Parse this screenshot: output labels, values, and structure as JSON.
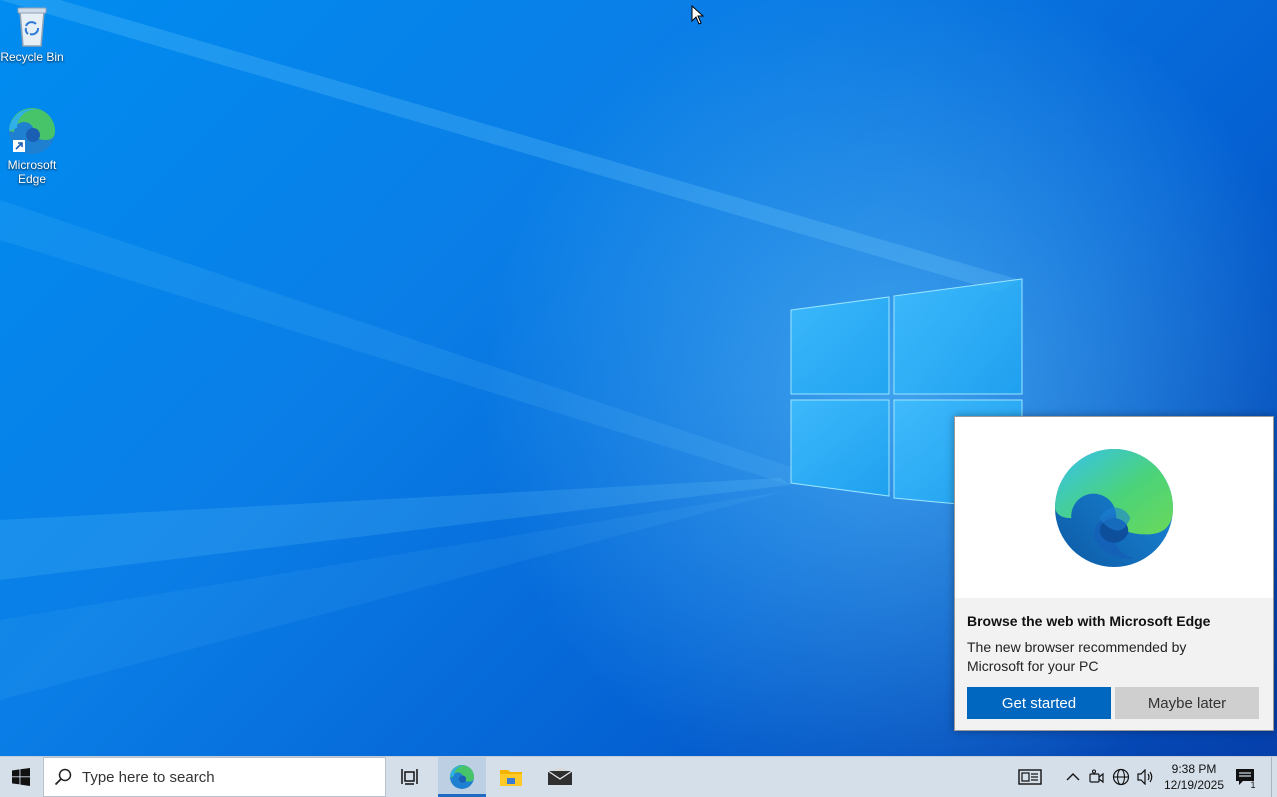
{
  "desktop": {
    "icons": [
      {
        "label": "Recycle Bin",
        "icon": "recycle-bin-icon"
      },
      {
        "label": "Microsoft Edge",
        "icon": "edge-icon"
      }
    ]
  },
  "popup": {
    "title": "Browse the web with Microsoft Edge",
    "body": "The new browser recommended by Microsoft for your PC",
    "primary_button": "Get started",
    "secondary_button": "Maybe later",
    "logo": "edge-logo"
  },
  "taskbar": {
    "search_placeholder": "Type here to search",
    "pinned": [
      "task-view-icon",
      "edge-icon",
      "file-explorer-icon",
      "mail-icon"
    ],
    "tray": {
      "icons": [
        "news-icon",
        "chevron-up-icon",
        "meet-now-icon",
        "network-icon",
        "volume-icon",
        "notifications-icon"
      ],
      "time": "9:38 PM",
      "date": "12/19/2025",
      "notification_count": "1"
    }
  },
  "colors": {
    "accent": "#0067c0",
    "taskbar": "#d5dfea",
    "desktop_blue": "#0a7ee6"
  }
}
